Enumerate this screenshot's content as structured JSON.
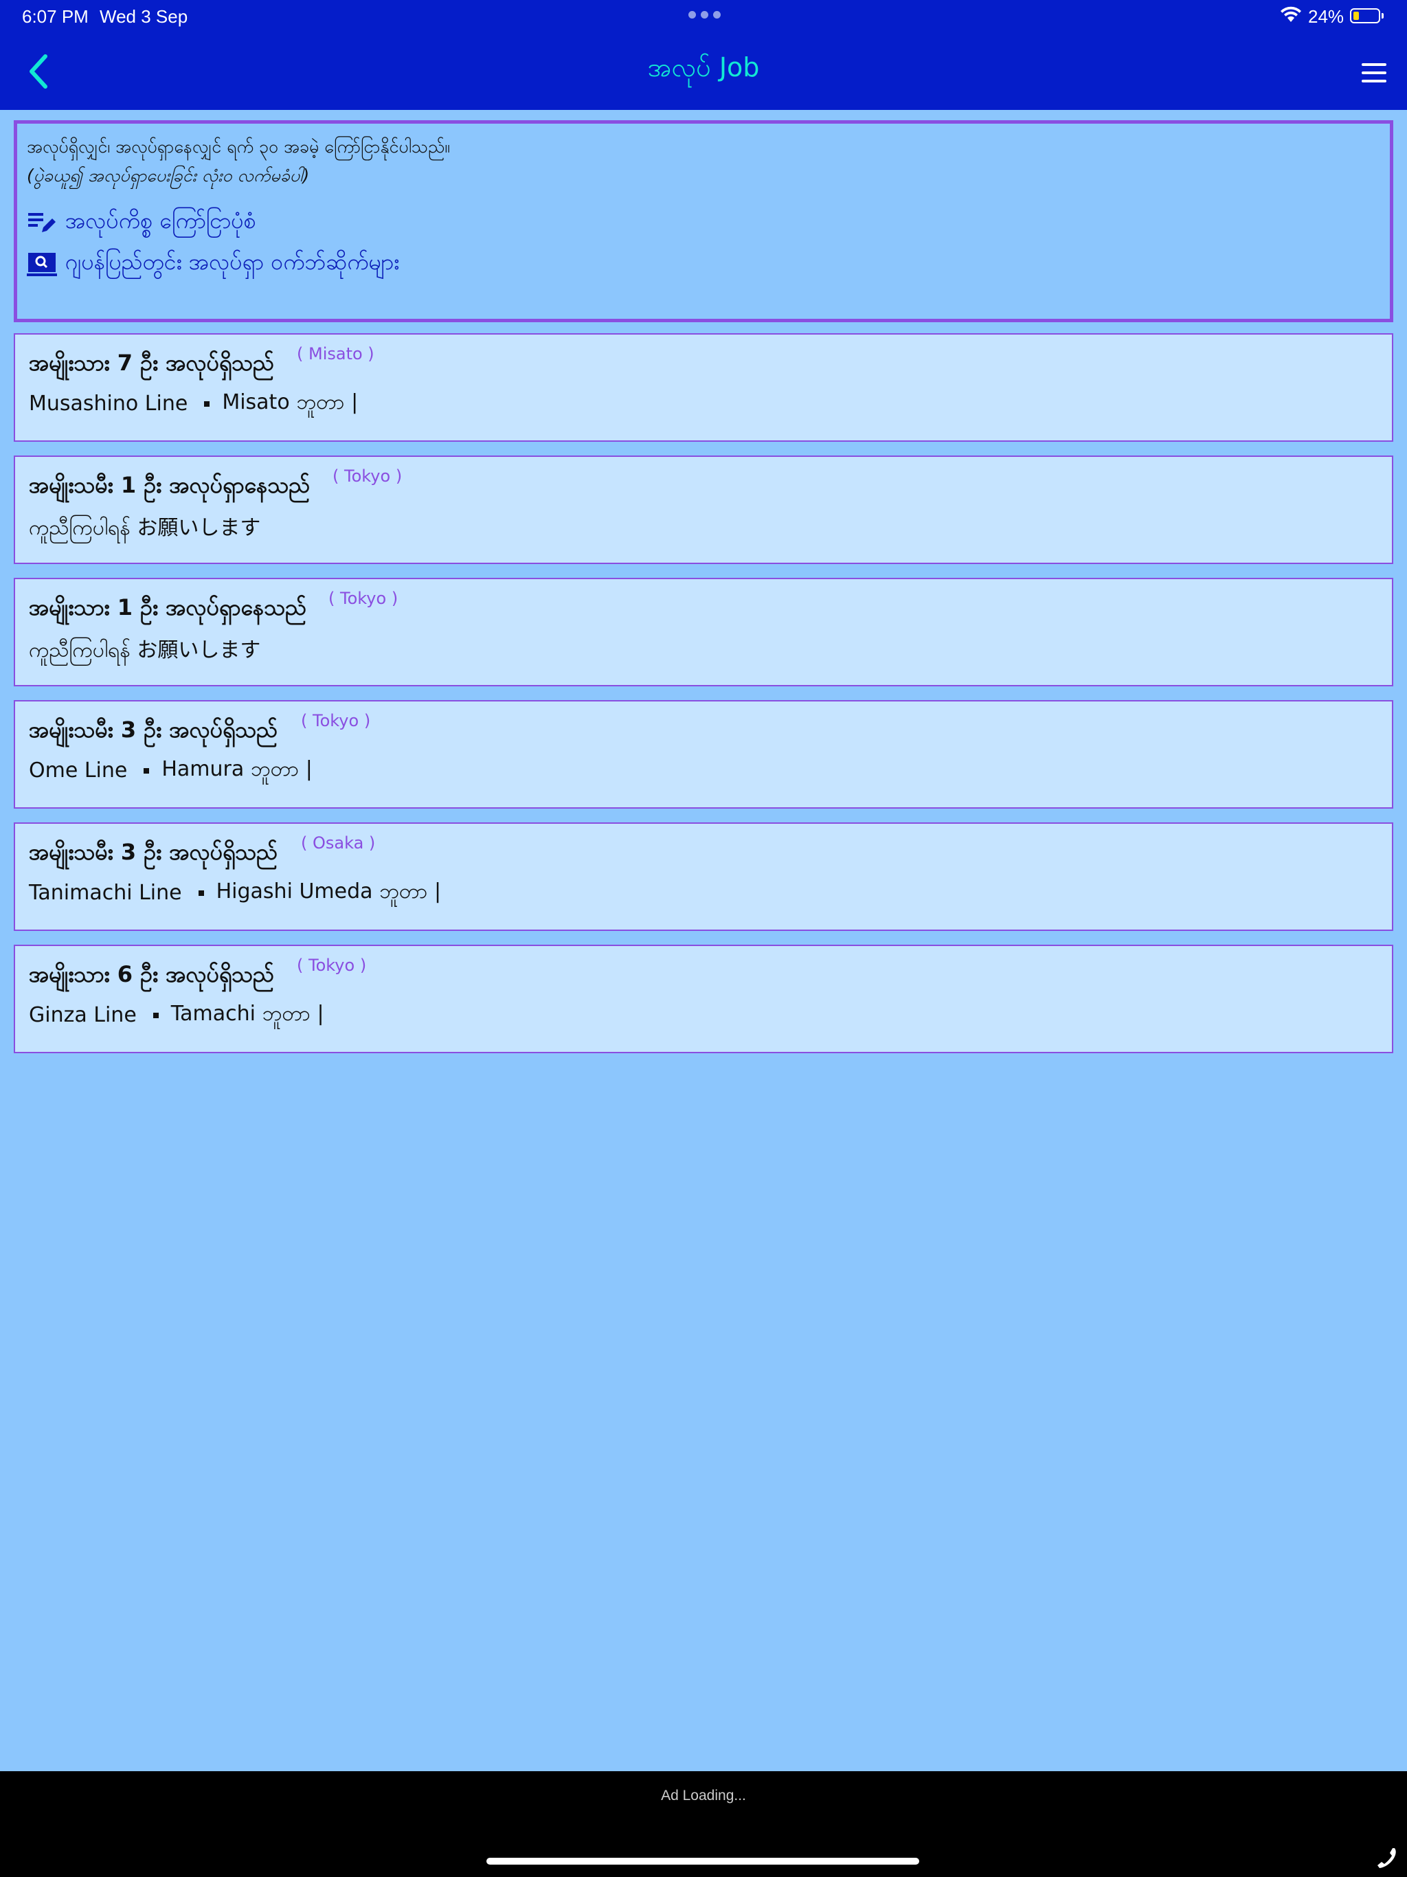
{
  "status_bar": {
    "time": "6:07 PM",
    "date": "Wed 3 Sep",
    "battery_percent": "24%",
    "battery_level": 0.24
  },
  "nav": {
    "title": "အလုပ် Job",
    "back_icon": "chevron-left-icon",
    "menu_icon": "hamburger-menu-icon",
    "accent_color": "#12e8d4",
    "bar_color": "#051dc9"
  },
  "info": {
    "line1": "အလုပ်ရှိလျှင်၊ အလုပ်ရှာနေလျှင် ရက် ၃၀ အခမဲ့ ကြော်ငြာနိုင်ပါသည်။",
    "line2": "(ပွဲခယူ၍ အလုပ်ရှာပေးခြင်း လုံးဝ လက်မခံပါ)",
    "link1": "အလုပ်ကိစ္စ ကြော်ငြာပုံစံ",
    "link1_icon": "edit-list-icon",
    "link2": "ဂျပန်ပြည်တွင်း အလုပ်ရှာ ဝက်ဘ်ဆိုက်များ",
    "link2_icon": "search-laptop-icon",
    "border_color": "#8a4ee0"
  },
  "jobs": [
    {
      "title": "အမျိုးသား 7 ဦး အလုပ်ရှိသည်",
      "city": "( Misato )",
      "line": "Musashino Line",
      "station": "Misato ဘူတာ |"
    },
    {
      "title": "အမျိုးသမီး 1 ဦး အလုပ်ရှာနေသည်",
      "city": "( Tokyo )",
      "line": "ကူညီကြပါရန် お願いします",
      "station": ""
    },
    {
      "title": "အမျိုးသား 1 ဦး အလုပ်ရှာနေသည်",
      "city": "( Tokyo )",
      "line": "ကူညီကြပါရန် お願いします",
      "station": ""
    },
    {
      "title": "အမျိုးသမီး 3 ဦး အလုပ်ရှိသည်",
      "city": "( Tokyo )",
      "line": "Ome Line",
      "station": "Hamura ဘူတာ |"
    },
    {
      "title": "အမျိုးသမီး 3 ဦး အလုပ်ရှိသည်",
      "city": "( Osaka )",
      "line": "Tanimachi Line",
      "station": "Higashi Umeda ဘူတာ |"
    },
    {
      "title": "အမျိုးသား 6 ဦး အလုပ်ရှိသည်",
      "city": "( Tokyo )",
      "line": "Ginza Line",
      "station": "Tamachi ဘူတာ |"
    }
  ],
  "ad": {
    "text": "Ad Loading...",
    "phone_icon": "phone-icon"
  }
}
